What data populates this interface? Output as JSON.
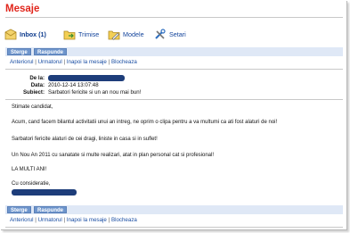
{
  "page": {
    "title": "Mesaje"
  },
  "nav": {
    "items": [
      {
        "label": "Inbox (1)",
        "icon": "inbox-icon",
        "active": true
      },
      {
        "label": "Trimise",
        "icon": "sent-folder-icon",
        "active": false
      },
      {
        "label": "Modele",
        "icon": "templates-icon",
        "active": false
      },
      {
        "label": "Setari",
        "icon": "settings-tools-icon",
        "active": false
      }
    ]
  },
  "toolbar": {
    "delete_label": "Sterge",
    "reply_label": "Raspunde"
  },
  "links": {
    "prev": "Anteriorul",
    "next": "Urmatorul",
    "back": "Inapoi la mesaje",
    "block": "Blocheaza",
    "separator": "|"
  },
  "message": {
    "from_label": "De la:",
    "date_label": "Data:",
    "date_value": "2010-12-14 13:07:48",
    "subject_label": "Subiect:",
    "subject_value": "Sarbatori fericite si un an nou mai bun!",
    "body": [
      "Stimate candidat,",
      "Acum, cand facem bilantul activitatii unui an intreg, ne oprim o clipa pentru a va multumi ca ati fost alaturi de noi!",
      "Sarbatori fericite alaturi de cei dragi, liniste in casa si in suflet!",
      "Un Nou An 2011 cu sanatate si multe realizari, atat in plan personal cat si profesional!",
      "LA MULTI ANI!",
      "Cu consideratie,"
    ]
  },
  "colors": {
    "title": "#e1251b",
    "link": "#1a4ea3",
    "button": "#6e95cc",
    "button_bar": "#dfe8f6",
    "redaction": "#1d3d7a"
  }
}
